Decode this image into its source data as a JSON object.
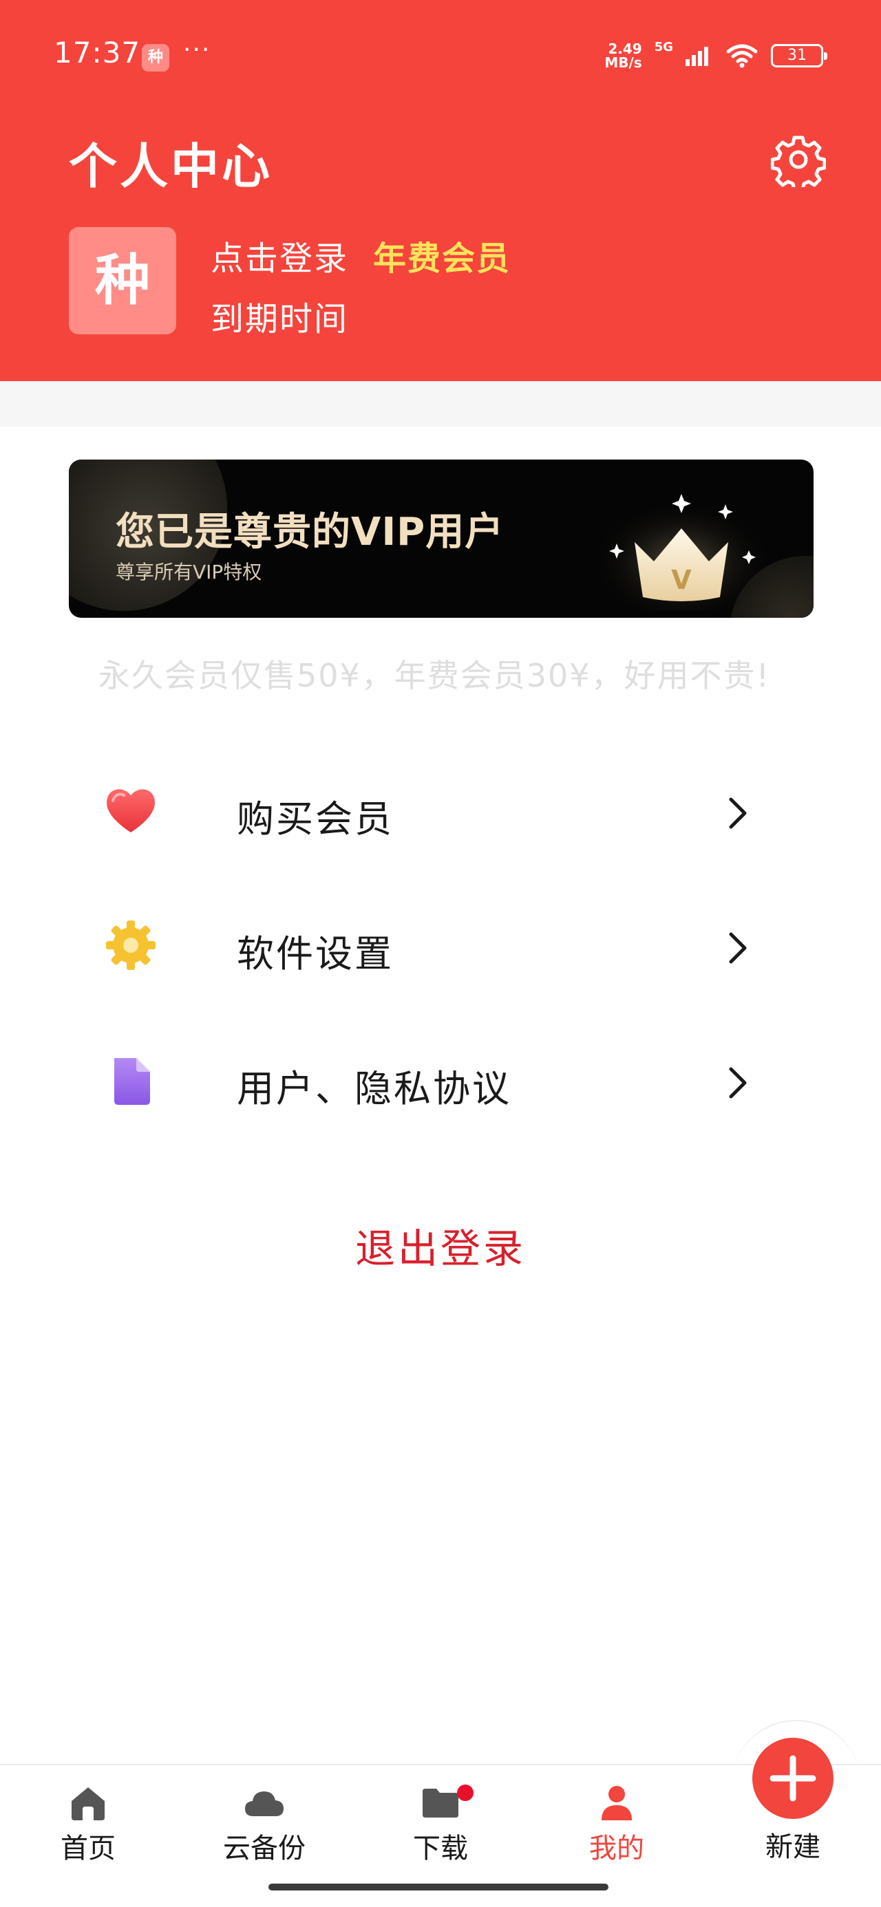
{
  "status_bar": {
    "time": "17:37",
    "app_icon_text": "种",
    "more_dots": "···",
    "net_speed_value": "2.49",
    "net_speed_unit": "MB/s",
    "network": "5G",
    "battery": "31"
  },
  "header": {
    "title": "个人中心",
    "avatar_char": "种",
    "login_label": "点击登录",
    "member_badge": "年费会员",
    "expire_label": "到期时间"
  },
  "vip_banner": {
    "title": "您已是尊贵的VIP用户",
    "subtitle": "尊享所有VIP特权",
    "crown_letter": "V"
  },
  "promo": "永久会员仅售50¥，年费会员30¥，好用不贵!",
  "menu": [
    {
      "label": "购买会员",
      "icon": "heart-icon"
    },
    {
      "label": "软件设置",
      "icon": "gear-icon"
    },
    {
      "label": "用户、隐私协议",
      "icon": "document-icon"
    }
  ],
  "logout_label": "退出登录",
  "bottom_nav": [
    {
      "label": "首页",
      "icon": "home-icon"
    },
    {
      "label": "云备份",
      "icon": "cloud-icon"
    },
    {
      "label": "下载",
      "icon": "folder-icon",
      "badge": true
    },
    {
      "label": "我的",
      "icon": "user-icon",
      "active": true
    },
    {
      "label": "新建",
      "icon": "plus-icon"
    }
  ],
  "colors": {
    "header_bg": "#f5443c",
    "badge_yellow": "#ffe35c",
    "logout_red": "#d8202c",
    "active_red": "#f1453e"
  }
}
